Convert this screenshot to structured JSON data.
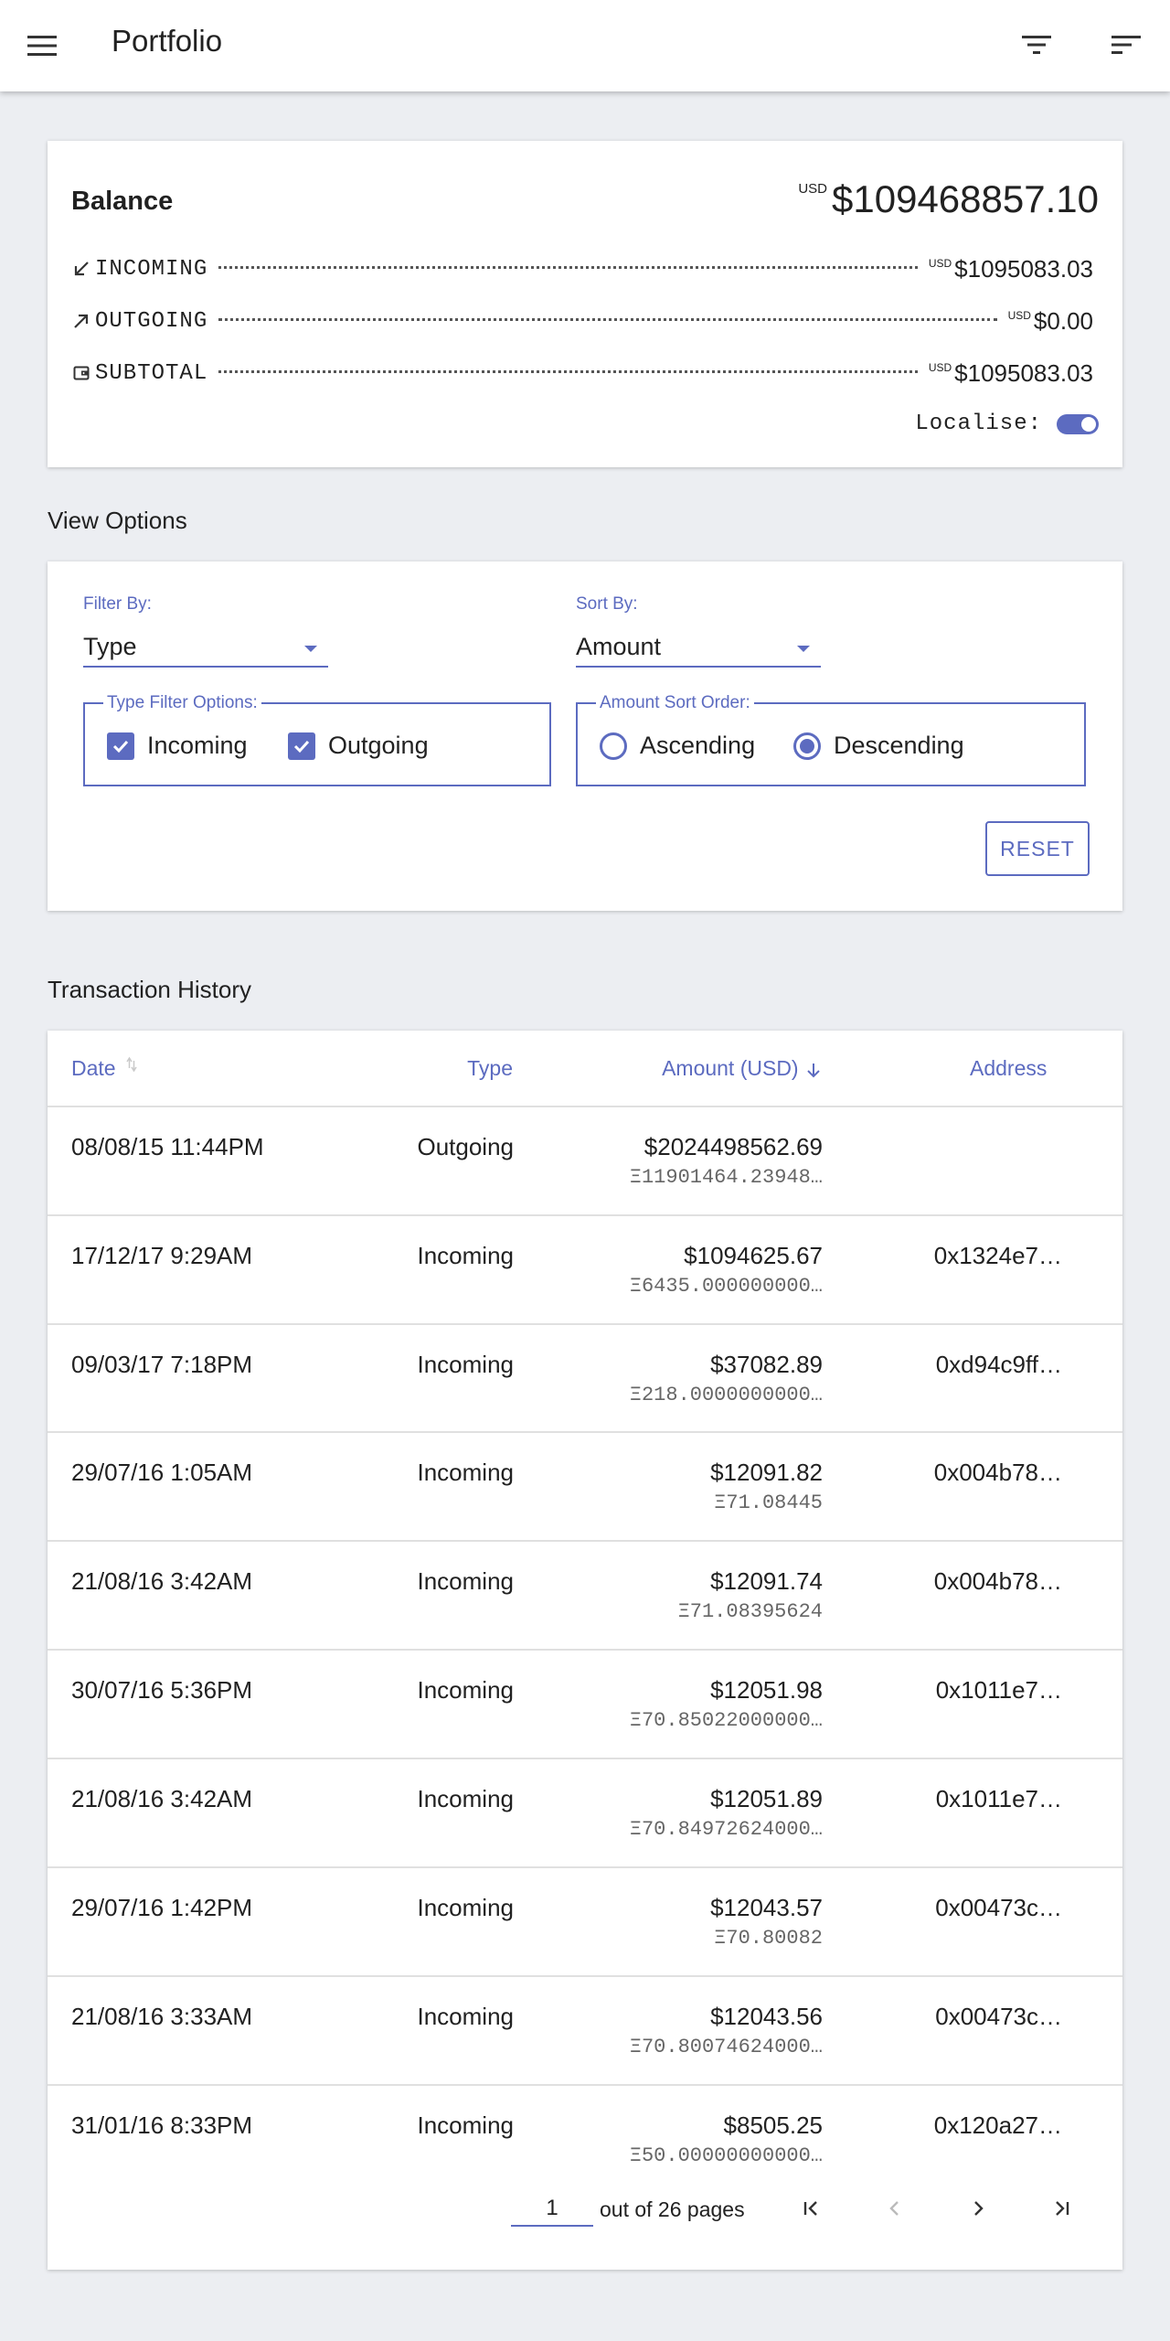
{
  "appbar": {
    "title": "Portfolio"
  },
  "balance": {
    "title": "Balance",
    "currency": "USD",
    "total": "$109468857.10",
    "rows": [
      {
        "icon": "arrow-down-left-icon",
        "label": "INCOMING",
        "currency": "USD",
        "value": "$1095083.03"
      },
      {
        "icon": "arrow-up-right-icon",
        "label": "OUTGOING",
        "currency": "USD",
        "value": "$0.00"
      },
      {
        "icon": "wallet-icon",
        "label": "SUBTOTAL",
        "currency": "USD",
        "value": "$1095083.03"
      }
    ],
    "localise_label": "Localise:",
    "localise_on": true
  },
  "view_options": {
    "title": "View Options",
    "filter_by_label": "Filter By:",
    "filter_by_value": "Type",
    "sort_by_label": "Sort By:",
    "sort_by_value": "Amount",
    "type_filter_legend": "Type Filter Options:",
    "incoming_label": "Incoming",
    "incoming_checked": true,
    "outgoing_label": "Outgoing",
    "outgoing_checked": true,
    "sort_order_legend": "Amount Sort Order:",
    "ascending_label": "Ascending",
    "descending_label": "Descending",
    "selected_order": "Descending",
    "reset_label": "RESET"
  },
  "transactions": {
    "title": "Transaction History",
    "columns": {
      "date": "Date",
      "type": "Type",
      "amount": "Amount (USD)",
      "address": "Address"
    },
    "rows": [
      {
        "date": "08/08/15 11:44PM",
        "type": "Outgoing",
        "amount": "$2024498562.69",
        "eth": "Ξ11901464.23948…",
        "address": ""
      },
      {
        "date": "17/12/17 9:29AM",
        "type": "Incoming",
        "amount": "$1094625.67",
        "eth": "Ξ6435.000000000…",
        "address": "0x1324e7…"
      },
      {
        "date": "09/03/17 7:18PM",
        "type": "Incoming",
        "amount": "$37082.89",
        "eth": "Ξ218.0000000000…",
        "address": "0xd94c9ff…"
      },
      {
        "date": "29/07/16 1:05AM",
        "type": "Incoming",
        "amount": "$12091.82",
        "eth": "Ξ71.08445",
        "address": "0x004b78…"
      },
      {
        "date": "21/08/16 3:42AM",
        "type": "Incoming",
        "amount": "$12091.74",
        "eth": "Ξ71.08395624",
        "address": "0x004b78…"
      },
      {
        "date": "30/07/16 5:36PM",
        "type": "Incoming",
        "amount": "$12051.98",
        "eth": "Ξ70.85022000000…",
        "address": "0x1011e7…"
      },
      {
        "date": "21/08/16 3:42AM",
        "type": "Incoming",
        "amount": "$12051.89",
        "eth": "Ξ70.84972624000…",
        "address": "0x1011e7…"
      },
      {
        "date": "29/07/16 1:42PM",
        "type": "Incoming",
        "amount": "$12043.57",
        "eth": "Ξ70.80082",
        "address": "0x00473c…"
      },
      {
        "date": "21/08/16 3:33AM",
        "type": "Incoming",
        "amount": "$12043.56",
        "eth": "Ξ70.80074624000…",
        "address": "0x00473c…"
      },
      {
        "date": "31/01/16 8:33PM",
        "type": "Incoming",
        "amount": "$8505.25",
        "eth": "Ξ50.00000000000…",
        "address": "0x120a27…"
      }
    ],
    "pagination": {
      "current_page": "1",
      "suffix": "out of 26 pages"
    }
  },
  "colors": {
    "accent": "#5c6bc0",
    "background": "#eceef2",
    "card": "#ffffff",
    "text": "#212121",
    "muted": "#666666"
  }
}
